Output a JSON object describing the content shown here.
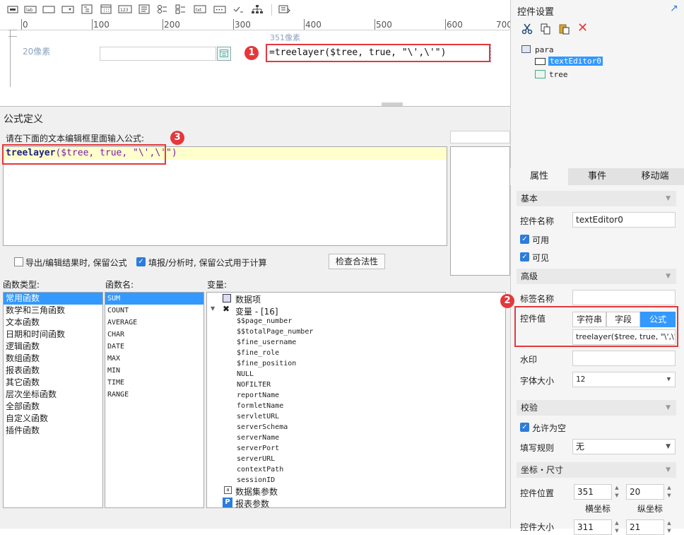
{
  "toolbar": {
    "icons": [
      "button-icon",
      "label-icon",
      "textbox-icon",
      "combobox-icon",
      "treecombo-icon",
      "date-icon",
      "number-icon",
      "textarea-icon",
      "radio-group-icon",
      "checkbox-group-icon",
      "text-icon",
      "password-icon",
      "checkbox-icon",
      "tree-icon",
      "tab-icon"
    ]
  },
  "ruler": {
    "marks": [
      "0",
      "100",
      "200",
      "300",
      "400",
      "500",
      "600",
      "700"
    ],
    "left_label": "20像素",
    "pos_label": "351像素"
  },
  "design": {
    "formula_text": "=treelayer($tree, true, \"\\',\\'\")"
  },
  "dialog": {
    "title": "公式定义",
    "instruction": "请在下面的文本编辑框里面输入公式:",
    "formula_fn": "treelayer",
    "formula_args": "($tree, true, \"\\',\\'\")",
    "opt1": "导出/编辑结果时, 保留公式",
    "opt2": "填报/分析时, 保留公式用于计算",
    "check_button": "检查合法性",
    "col_types": "函数类型:",
    "col_names": "函数名:",
    "col_vars": "变量:",
    "func_types": [
      "常用函数",
      "数学和三角函数",
      "文本函数",
      "日期和时间函数",
      "逻辑函数",
      "数组函数",
      "报表函数",
      "其它函数",
      "层次坐标函数",
      "全部函数",
      "自定义函数",
      "插件函数"
    ],
    "func_names": [
      "SUM",
      "COUNT",
      "AVERAGE",
      "CHAR",
      "DATE",
      "MAX",
      "MIN",
      "TIME",
      "RANGE"
    ],
    "vars_root1": "数据项",
    "vars_root2": "变量 - [16]",
    "vars": [
      "$$page_number",
      "$$totalPage_number",
      "$fine_username",
      "$fine_role",
      "$fine_position",
      "NULL",
      "NOFILTER",
      "reportName",
      "formletName",
      "servletURL",
      "serverSchema",
      "serverName",
      "serverPort",
      "serverURL",
      "contextPath",
      "sessionID"
    ],
    "vars_root3": "数据集参数",
    "vars_root4": "报表参数"
  },
  "panel": {
    "title": "控件设置",
    "tree_root": "para",
    "tree_child1": "textEditor0",
    "tree_child2": "tree",
    "tabs": [
      "属性",
      "事件",
      "移动端"
    ],
    "sec_basic": "基本",
    "lbl_name": "控件名称",
    "val_name": "textEditor0",
    "lbl_enabled": "可用",
    "lbl_visible": "可见",
    "sec_advanced": "高级",
    "lbl_tagname": "标签名称",
    "lbl_value": "控件值",
    "value_tabs": [
      "字符串",
      "字段",
      "公式"
    ],
    "value_formula": "treelayer($tree, true, \"\\',\\'\")",
    "lbl_watermark": "水印",
    "lbl_fontsize": "字体大小",
    "val_fontsize": "12",
    "sec_validate": "校验",
    "lbl_allow_empty": "允许为空",
    "lbl_rule": "填写规则",
    "val_rule": "无",
    "sec_coord": "坐标・尺寸",
    "lbl_pos": "控件位置",
    "pos_x": "351",
    "pos_y": "20",
    "lbl_x": "横坐标",
    "lbl_y": "纵坐标",
    "lbl_size": "控件大小",
    "size_w": "311",
    "size_h": "21"
  },
  "badges": [
    "1",
    "2",
    "3"
  ],
  "colors": {
    "accent": "#3399ff",
    "badge": "#e5383b",
    "formula_bg": "#ffffcc"
  }
}
